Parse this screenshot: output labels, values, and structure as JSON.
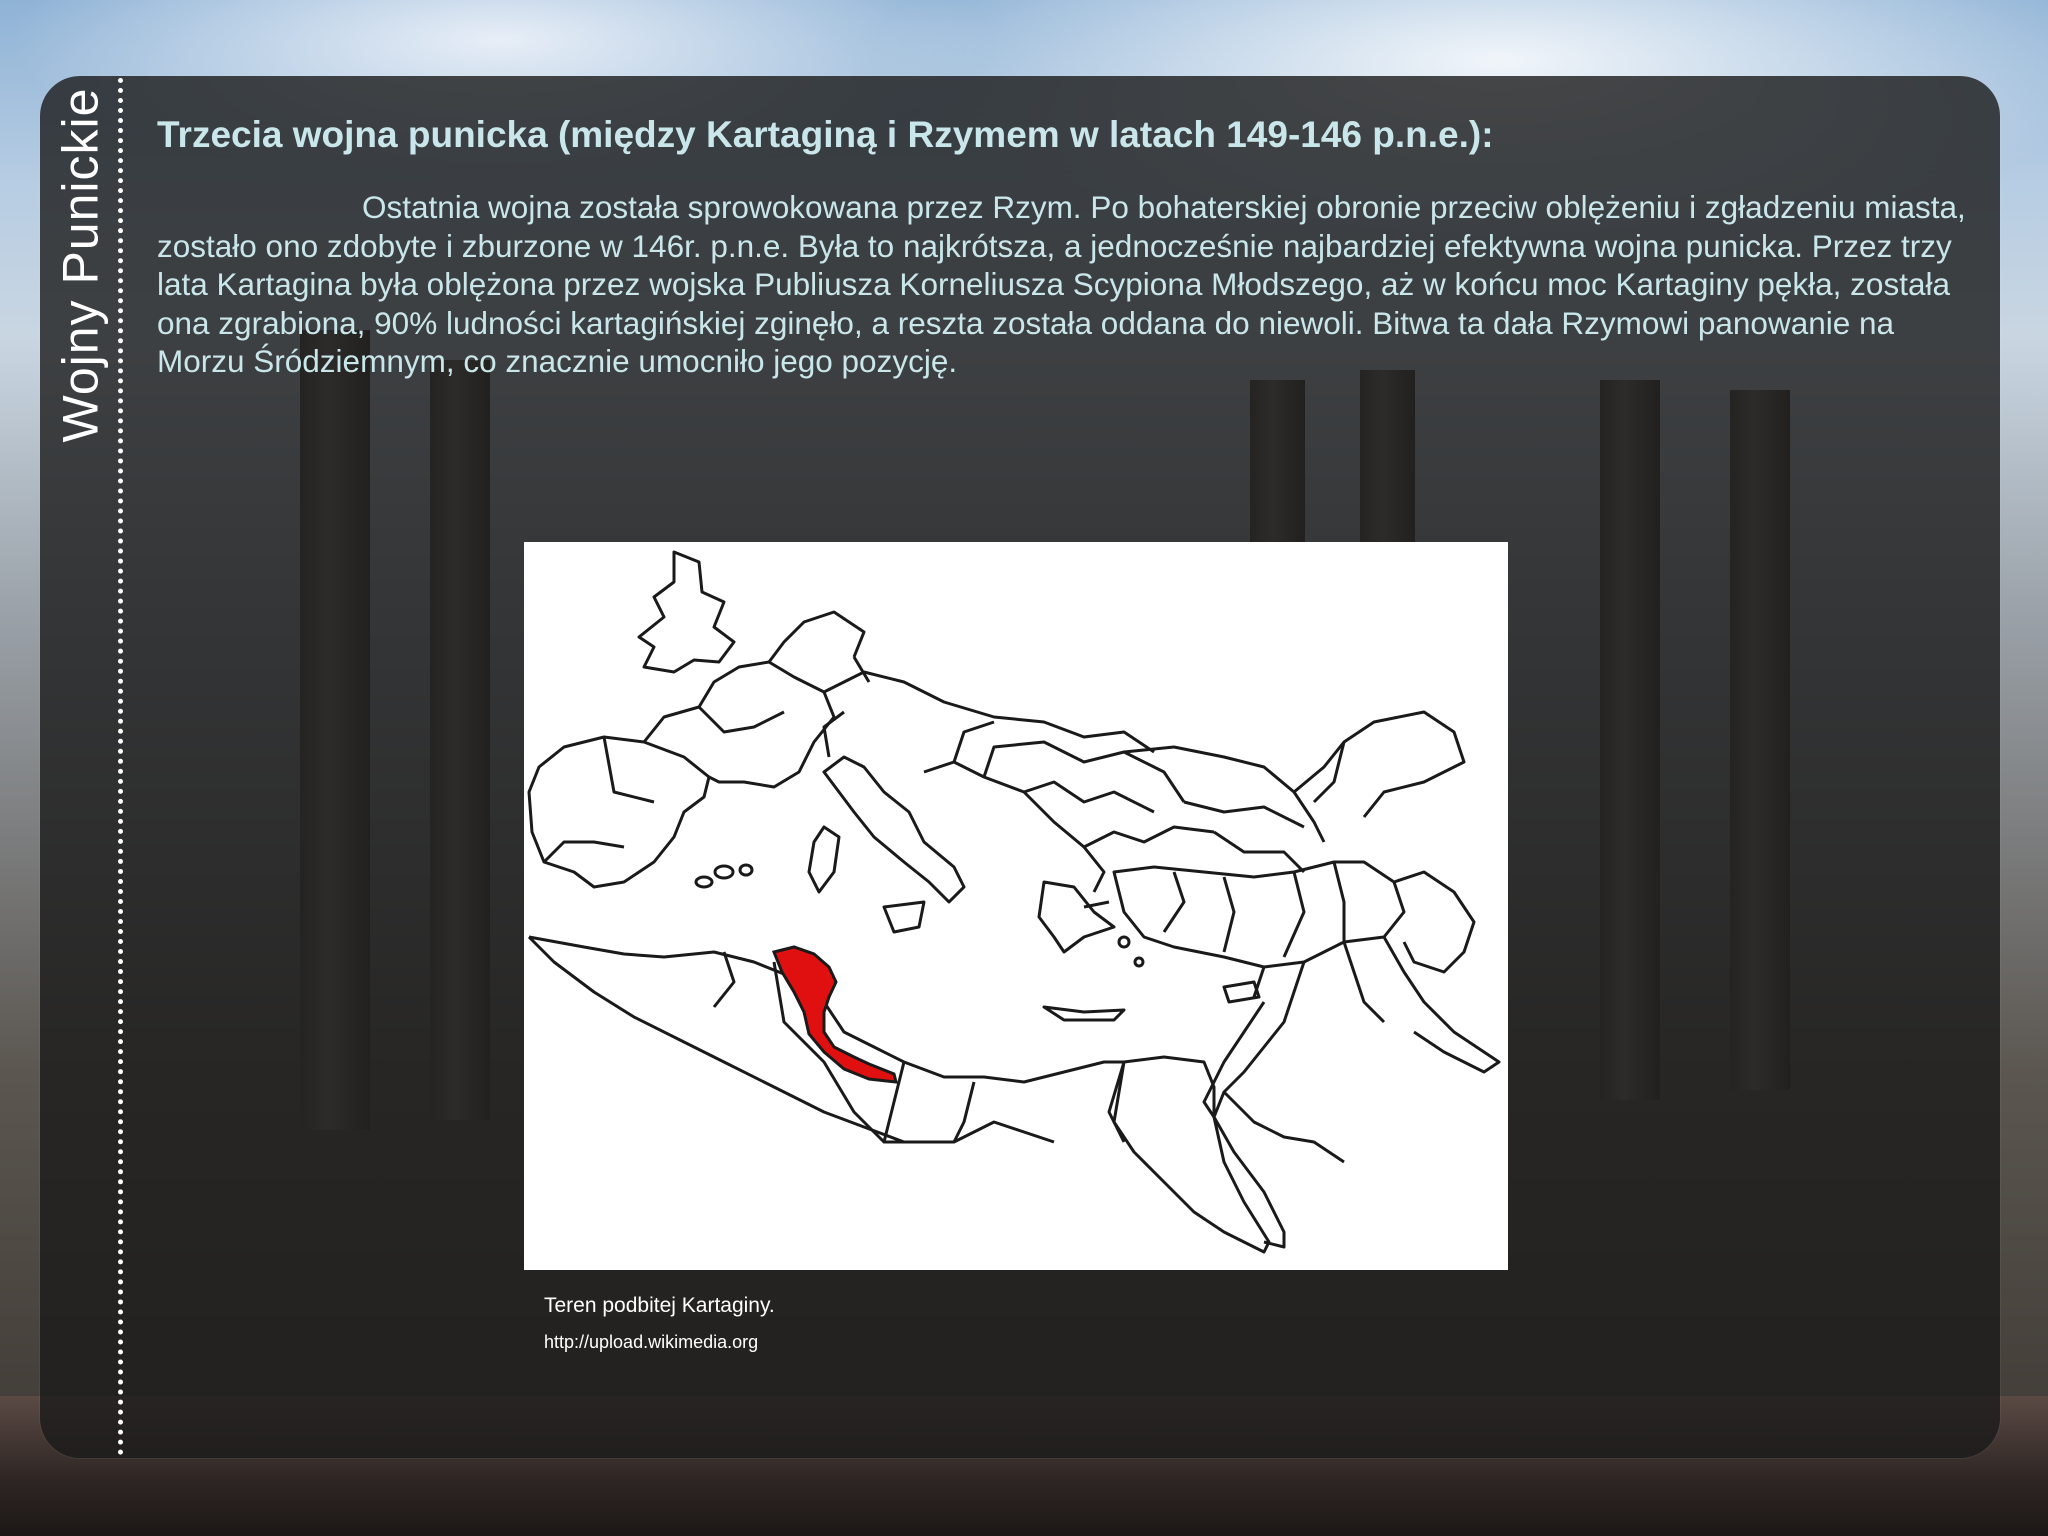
{
  "slide": {
    "side_title": "Wojny Punickie",
    "heading": "Trzecia wojna punicka (między Kartaginą i Rzymem w latach 149-146 p.n.e.):",
    "body": "Ostatnia wojna została sprowokowana przez Rzym. Po bohaterskiej obronie przeciw oblężeniu i zgładzeniu miasta, zostało ono zdobyte i zburzone w 146r. p.n.e. Była to najkrótsza, a jednocześnie najbardziej efektywna wojna punicka. Przez trzy lata Kartagina była oblężona przez wojska Publiusza Korneliusza Scypiona Młodszego, aż w końcu moc Kartaginy pękła, została ona zgrabiona, 90% ludności kartagińskiej zginęło, a reszta została oddana do niewoli. Bitwa ta dała Rzymowi panowanie na Morzu Śródziemnym, co znacznie umocniło jego pozycję.",
    "map_caption": "Teren podbitej Kartaginy.",
    "map_source": "http://upload.wikimedia.org"
  },
  "map": {
    "outline_color": "#1a1a1a",
    "highlight_color": "#e01010",
    "highlight_region": "Carthage"
  }
}
